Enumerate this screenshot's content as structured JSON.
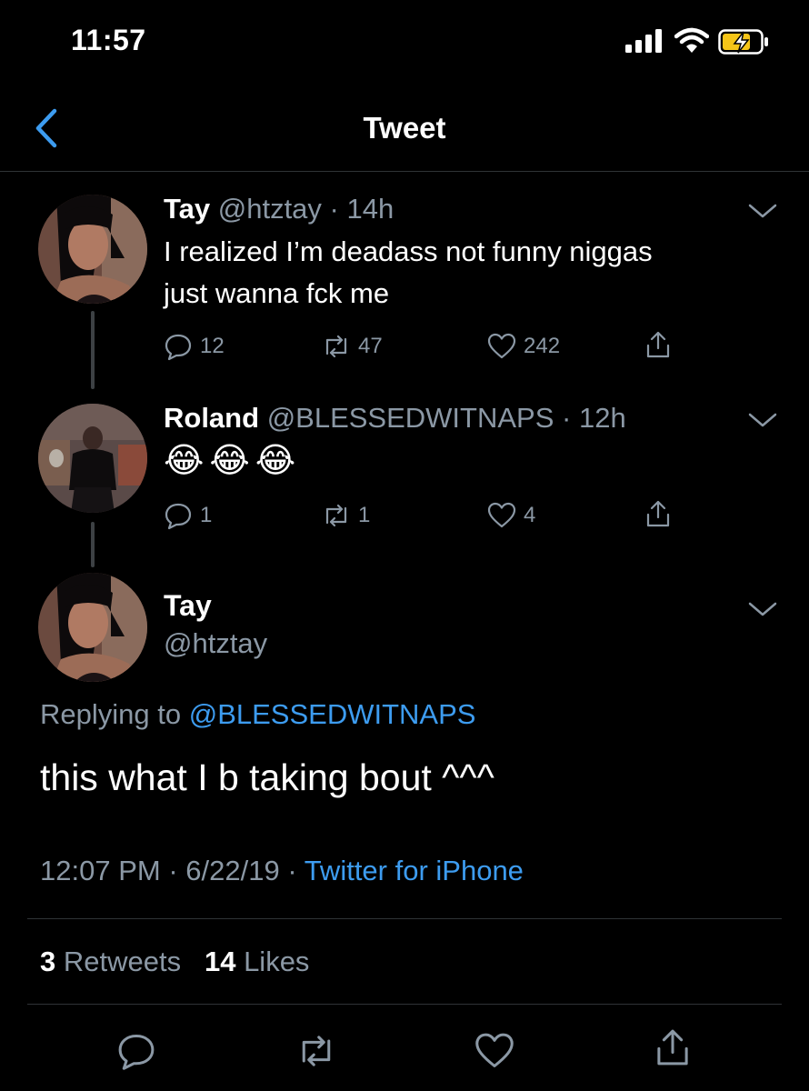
{
  "status_bar": {
    "time": "11:57"
  },
  "header": {
    "title": "Tweet"
  },
  "tweets": [
    {
      "name": "Tay",
      "handle": "@htztay",
      "time": "14h",
      "text_line1": "I realized I’m deadass not funny niggas",
      "text_line2": "just wanna fck me",
      "replies": "12",
      "retweets": "47",
      "likes": "242"
    },
    {
      "name": "Roland",
      "handle": "@BLESSEDWITNAPS",
      "time": "12h",
      "text": "😂😂😂",
      "replies": "1",
      "retweets": "1",
      "likes": "4"
    }
  ],
  "focus_tweet": {
    "name": "Tay",
    "handle": "@htztay",
    "replying_prefix": "Replying to",
    "replying_to": "@BLESSEDWITNAPS",
    "text": "this what I b taking bout ^^^",
    "time": "12:07 PM",
    "date": "6/22/19",
    "source": "Twitter for iPhone",
    "retweets_count": "3",
    "retweets_label": "Retweets",
    "likes_count": "14",
    "likes_label": "Likes"
  },
  "icons": {
    "back": "chevron-left-icon",
    "caret": "chevron-down-icon",
    "reply": "reply-icon",
    "retweet": "retweet-icon",
    "like": "heart-icon",
    "share": "share-icon"
  },
  "colors": {
    "background": "#000000",
    "accent": "#3d9cf0",
    "secondary_text": "#8b98a5",
    "divider": "#2f3336",
    "battery_fill": "#f5c518"
  }
}
